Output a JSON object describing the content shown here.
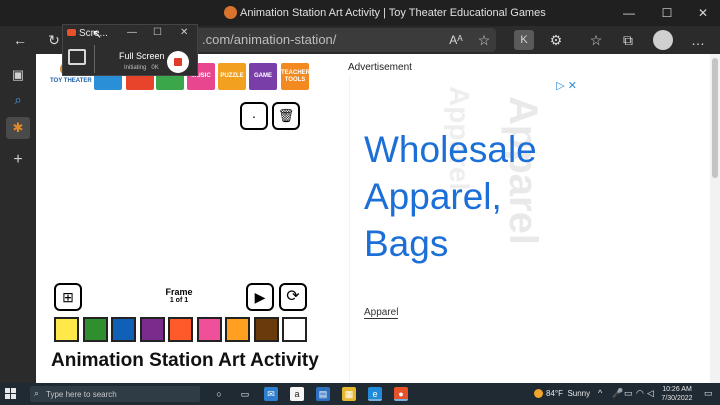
{
  "window": {
    "title": "Animation Station Art Activity | Toy Theater Educational Games",
    "minimize": "—",
    "maximize": "☐",
    "close": "✕"
  },
  "browser": {
    "url_visible": ".com/animation-station/",
    "back_icon": "←",
    "refresh_icon": "↻",
    "read_aloud": "Aᴬ",
    "favorite_icon": "☆",
    "extensions_icon": "⚙",
    "favorites_icon": "☆",
    "collections_icon": "⧉",
    "more_icon": "…"
  },
  "rail": {
    "items": [
      {
        "name": "tab-actions",
        "glyph": "▣"
      },
      {
        "name": "search",
        "glyph": "⌕"
      },
      {
        "name": "active-tab",
        "glyph": "✱"
      },
      {
        "name": "new-tab",
        "glyph": "+"
      }
    ]
  },
  "recorder": {
    "title": "Scre...",
    "mode_label": "Full Screen",
    "status": "Initiating",
    "status_ok": "0K",
    "minimize": "—",
    "maximize": "☐",
    "close": "✕"
  },
  "site": {
    "logo_text": "TOY THEATER",
    "categories": [
      {
        "label": "",
        "color": "#2b8fd8"
      },
      {
        "label": "",
        "color": "#e8432b"
      },
      {
        "label": "",
        "color": "#3aa84a"
      },
      {
        "label": "MUSIC",
        "color": "#e8468f"
      },
      {
        "label": "PUZZLE",
        "color": "#f2a020"
      },
      {
        "label": "GAME",
        "color": "#7a3ea8"
      },
      {
        "label": "TEACHER TOOLS",
        "color": "#f28a20"
      }
    ]
  },
  "tools": {
    "dot_glyph": "·",
    "trash_glyph": "🗑",
    "add_frame_glyph": "⊞",
    "play_glyph": "▶",
    "loop_glyph": "⟳"
  },
  "frame": {
    "label": "Frame",
    "count": "1 of 1"
  },
  "palette": [
    "#ffe94a",
    "#2f8f2f",
    "#1060b8",
    "#7a2c8c",
    "#ff5a2a",
    "#f0509a",
    "#ffa020",
    "#6b3a0a",
    "#ffffff"
  ],
  "heading": "Animation Station Art Activity",
  "ad": {
    "label": "Advertisement",
    "headline_lines": [
      "Wholesale",
      "Apparel,",
      "Bags"
    ],
    "link_text": "Apparel",
    "watermark": "Apparel",
    "ad_choices": "▷ ✕"
  },
  "taskbar": {
    "search_placeholder": "Type here to search",
    "weather_temp": "84°F",
    "weather_desc": "Sunny",
    "time": "10:26 AM",
    "date": "7/30/2022"
  }
}
